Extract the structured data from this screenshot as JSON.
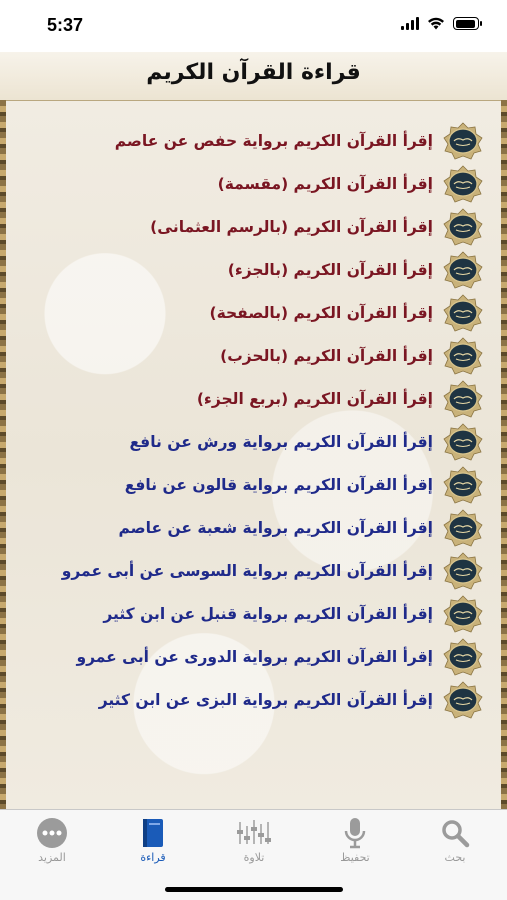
{
  "status": {
    "time": "5:37"
  },
  "header": {
    "title": "قراءة القرآن الكريم"
  },
  "colors": {
    "maroon": "#7a1622",
    "blue": "#1f2a8a",
    "tab_active": "#1a5bb8",
    "tab_inactive": "#9b9b9b"
  },
  "menu": {
    "items": [
      {
        "label": "إقرأ القرآن الكريم برواية حفص عن عاصم",
        "color": "maroon",
        "icon": "mushaf-emblem-icon"
      },
      {
        "label": "إقرأ القرآن الكريم (مقسمة)",
        "color": "maroon",
        "icon": "mushaf-emblem-icon"
      },
      {
        "label": "إقرأ القرآن الكريم (بالرسم العثمانى)",
        "color": "maroon",
        "icon": "mushaf-emblem-icon"
      },
      {
        "label": "إقرأ القرآن الكريم (بالجزء)",
        "color": "maroon",
        "icon": "mushaf-emblem-icon"
      },
      {
        "label": "إقرأ القرآن الكريم (بالصفحة)",
        "color": "maroon",
        "icon": "mushaf-emblem-icon"
      },
      {
        "label": "إقرأ القرآن الكريم (بالحزب)",
        "color": "maroon",
        "icon": "mushaf-emblem-icon"
      },
      {
        "label": "إقرأ القرآن الكريم (بربع الجزء)",
        "color": "maroon",
        "icon": "mushaf-emblem-icon"
      },
      {
        "label": "إقرأ القرآن الكريم برواية ورش عن نافع",
        "color": "blue",
        "icon": "mushaf-emblem-icon"
      },
      {
        "label": "إقرأ القرآن الكريم برواية قالون عن نافع",
        "color": "blue",
        "icon": "mushaf-emblem-icon"
      },
      {
        "label": "إقرأ القرآن الكريم برواية شعبة عن عاصم",
        "color": "blue",
        "icon": "mushaf-emblem-icon"
      },
      {
        "label": "إقرأ القرآن الكريم برواية السوسى عن أبى عمرو",
        "color": "blue",
        "icon": "mushaf-emblem-icon"
      },
      {
        "label": "إقرأ القرآن الكريم برواية قنبل عن ابن كثير",
        "color": "blue",
        "icon": "mushaf-emblem-icon"
      },
      {
        "label": "إقرأ القرآن الكريم برواية الدورى عن أبى عمرو",
        "color": "blue",
        "icon": "mushaf-emblem-icon"
      },
      {
        "label": "إقرأ القرآن الكريم برواية البزى عن ابن كثير",
        "color": "blue",
        "icon": "mushaf-emblem-icon"
      }
    ]
  },
  "tabs": [
    {
      "label": "بحث",
      "icon": "search-icon",
      "active": false
    },
    {
      "label": "تحفيظ",
      "icon": "microphone-icon",
      "active": false
    },
    {
      "label": "تلاوة",
      "icon": "equalizer-icon",
      "active": false
    },
    {
      "label": "قراءة",
      "icon": "book-icon",
      "active": true
    },
    {
      "label": "المزيد",
      "icon": "more-icon",
      "active": false
    }
  ]
}
